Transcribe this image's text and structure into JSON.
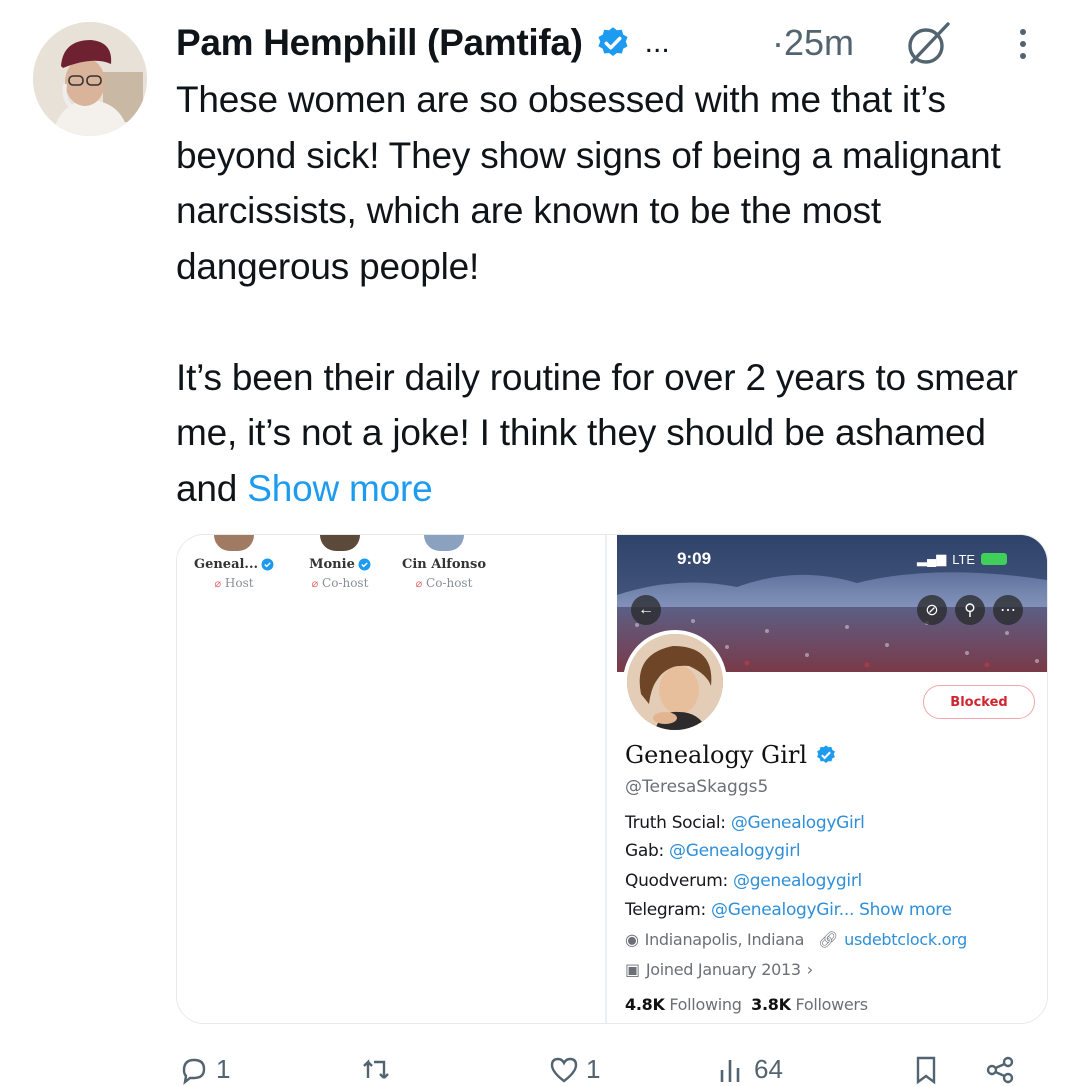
{
  "tweet": {
    "author_name": "Pam Hemphill (Pamtifa)",
    "truncation": "...",
    "time": "·25m",
    "text": "These women are so obsessed with me that it’s beyond sick! They show signs of being a malignant narcissists, which are known to be the most dangerous people!\n\nIt’s been their daily routine for over 2 years to smear me, it’s not a joke! I think they should be ashamed and ",
    "show_more": "Show more",
    "colors": {
      "accent": "#1d9bf0",
      "verified": "#1d9bf0",
      "secondary_text": "#536471"
    }
  },
  "media": {
    "space_speakers": [
      {
        "name": "Geneal...",
        "role": "Host",
        "verified": true
      },
      {
        "name": "Monie",
        "role": "Co-host",
        "verified": true
      },
      {
        "name": "Cin Alfonso",
        "role": "Co-host",
        "verified": false
      }
    ],
    "profile": {
      "status_time": "9:09",
      "network": "LTE",
      "blocked_label": "Blocked",
      "display_name": "Genealogy Girl",
      "handle": "@TeresaSkaggs5",
      "bio": [
        {
          "label": "Truth Social:",
          "link": "@GenealogyGirl"
        },
        {
          "label": "Gab:",
          "link": "@Genealogygirl"
        },
        {
          "label": "Quodverum:",
          "link": "@genealogygirl"
        },
        {
          "label": "Telegram:",
          "link": "@GenealogyGir...",
          "more": "Show more"
        }
      ],
      "location": "Indianapolis, Indiana",
      "website": "usdebtclock.org",
      "joined": "Joined January 2013",
      "following_count": "4.8K",
      "following_label": "Following",
      "followers_count": "3.8K",
      "followers_label": "Followers"
    }
  },
  "actions": {
    "reply_count": "1",
    "like_count": "1",
    "views_count": "64"
  }
}
